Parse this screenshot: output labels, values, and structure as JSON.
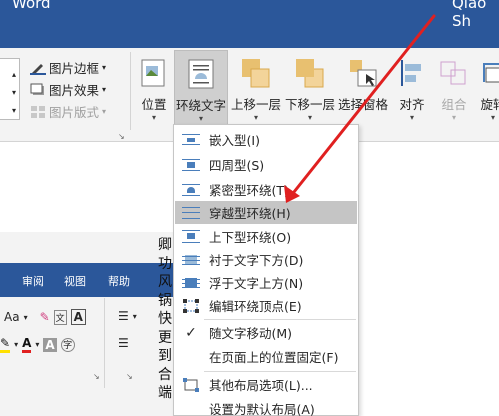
{
  "titlebar": {
    "app": "Word",
    "user": "Qiao Sh"
  },
  "ribbon": {
    "small_buttons": [
      "图片边框",
      "图片效果",
      "图片版式"
    ],
    "big_buttons": [
      "位置",
      "环绕文字",
      "上移一层",
      "下移一层",
      "选择窗格",
      "对齐",
      "组合",
      "旋转"
    ]
  },
  "wrap_menu": {
    "items": [
      "嵌入型(I)",
      "四周型(S)",
      "紧密型环绕(T)",
      "穿越型环绕(H)",
      "上下型环绕(O)",
      "衬于文字下方(D)",
      "浮于文字上方(N)",
      "编辑环绕顶点(E)",
      "随文字移动(M)",
      "在页面上的位置固定(F)",
      "其他布局选项(L)...",
      "设置为默认布局(A)"
    ],
    "checked_item": "随文字移动(M)",
    "highlighted_item": "穿越型环绕(H)"
  },
  "inner_screenshot": {
    "tabs": [
      "审阅",
      "视图",
      "帮助"
    ],
    "row1": "Aa",
    "vertical_text": [
      "卿",
      "功",
      "风",
      "锅",
      "快",
      "更",
      "到",
      "合",
      "端"
    ]
  },
  "colors": {
    "title_blue": "#2b579a",
    "arrow_red": "#e02020",
    "menu_highlight": "#c5c5c5",
    "icon_blue": "#4a7ebb"
  }
}
